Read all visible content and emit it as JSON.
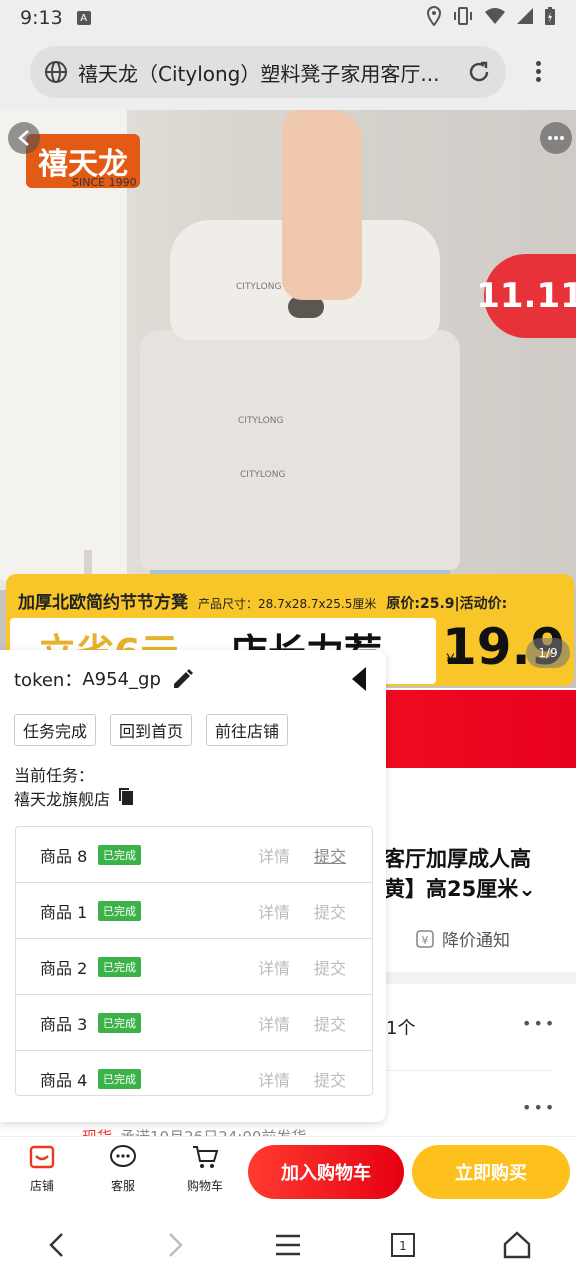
{
  "status_bar": {
    "time": "9:13",
    "icons": [
      "notification-a-icon",
      "location-icon",
      "vibrate-icon",
      "wifi-icon",
      "signal-icon",
      "battery-icon"
    ]
  },
  "browser": {
    "url_title": "禧天龙（Citylong）塑料凳子家用客厅...",
    "menu_icon": "kebab-menu-icon"
  },
  "hero": {
    "logo_text": "禧天龙",
    "logo_since": "SINCE 1990",
    "sale_badge": "11.11",
    "stool_brand_label": "CITYLONG",
    "banner_title": "加厚北欧简约节节方凳",
    "banner_size": "产品尺寸：28.7x28.7x25.5厘米",
    "banner_orig": "原价:25.9|活动价:",
    "banner_big_left": "立省6元",
    "banner_big_right": "店长力荐",
    "banner_yen": "¥",
    "banner_price": "19.9",
    "page_indicator": "1/9"
  },
  "product": {
    "title_line1": "客厅加厚成人高",
    "title_line2": "黄】高25厘米⌄",
    "price_notify": "降价通知",
    "option_text": "1个",
    "shipping_tag": "现货",
    "shipping_text": "承诺10月26日24:00前发货"
  },
  "panel": {
    "token_label": "token：",
    "token_value": "A954_gp",
    "buttons": [
      "任务完成",
      "回到首页",
      "前往店铺"
    ],
    "current_task_label": "当前任务：",
    "current_task_value": "禧天龙旗舰店",
    "items": [
      {
        "name": "商品 8",
        "status": "已完成",
        "detail": "详情",
        "submit": "提交"
      },
      {
        "name": "商品 1",
        "status": "已完成",
        "detail": "详情",
        "submit": "提交"
      },
      {
        "name": "商品 2",
        "status": "已完成",
        "detail": "详情",
        "submit": "提交"
      },
      {
        "name": "商品 3",
        "status": "已完成",
        "detail": "详情",
        "submit": "提交"
      },
      {
        "name": "商品 4",
        "status": "已完成",
        "detail": "详情",
        "submit": "提交"
      }
    ]
  },
  "action_bar": {
    "store": "店铺",
    "service": "客服",
    "cart": "购物车",
    "add_to_cart": "加入购物车",
    "buy_now": "立即购买"
  },
  "colors": {
    "accent_red": "#e60012",
    "accent_yellow": "#fdc01d",
    "done_green": "#3bb34a"
  }
}
